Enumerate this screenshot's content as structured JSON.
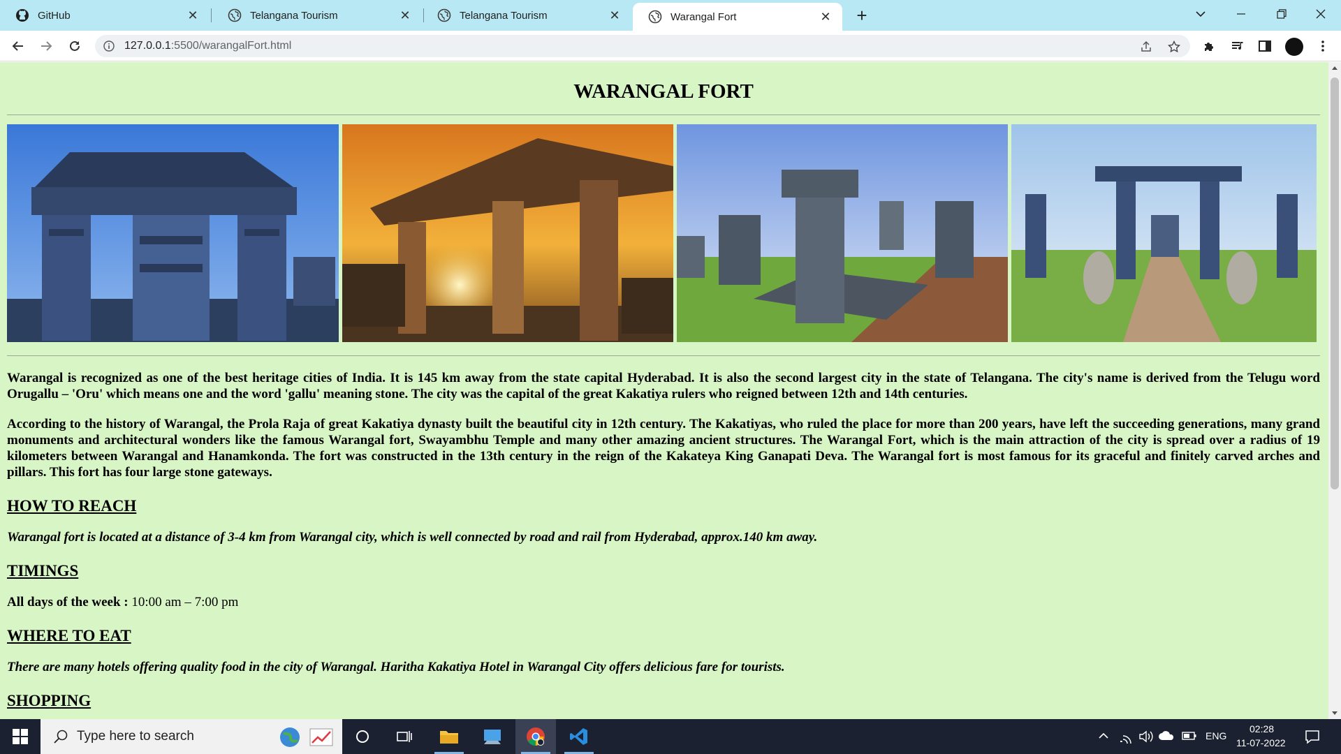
{
  "browser": {
    "tabs": [
      {
        "title": "GitHub",
        "icon": "github-icon",
        "active": false
      },
      {
        "title": "Telangana Tourism",
        "icon": "globe-icon",
        "active": false
      },
      {
        "title": "Telangana Tourism",
        "icon": "globe-icon",
        "active": false
      },
      {
        "title": "Warangal Fort",
        "icon": "globe-icon",
        "active": true
      }
    ],
    "url_host": "127.0.0.1",
    "url_path": ":5500/warangalFort.html"
  },
  "page": {
    "title": "WARANGAL FORT",
    "gallery": [
      {
        "alt": "thousand-pillar-temple-ruins-blue-photo"
      },
      {
        "alt": "sunset-pillared-mandapa-photo"
      },
      {
        "alt": "stone-pillars-garden-photo"
      },
      {
        "alt": "gateway-elephants-photo"
      }
    ],
    "intro": "Warangal is recognized as one of the best heritage cities of India. It is 145 km away from the state capital Hyderabad. It is also the second largest city in the state of Telangana. The city's name is derived from the Telugu word Orugallu – 'Oru' which means one and the word 'gallu' meaning stone. The city was the capital of the great Kakatiya rulers who reigned between 12th and 14th centuries.",
    "history": "According to the history of Warangal, the Prola Raja of great Kakatiya dynasty built the beautiful city in 12th century. The Kakatiyas, who ruled the place for more than 200 years, have left the succeeding generations, many grand monuments and architectural wonders like the famous Warangal fort, Swayambhu Temple and many other amazing ancient structures. The Warangal Fort, which is the main attraction of the city is spread over a radius of 19 kilometers between Warangal and Hanamkonda. The fort was constructed in the 13th century in the reign of the Kakateya King Ganapati Deva. The Warangal fort is most famous for its graceful and finitely carved arches and pillars. This fort has four large stone gateways.",
    "reach_heading": "HOW TO REACH",
    "reach_text": "Warangal fort is located at a distance of 3-4 km from Warangal city, which is well connected by road and rail from Hyderabad, approx.140 km away.",
    "timings_heading": "TIMINGS",
    "timings_label": "All days of the week :",
    "timings_value": "10:00 am – 7:00 pm",
    "eat_heading": "WHERE TO EAT",
    "eat_text": "There are many hotels offering quality food in the city of Warangal. Haritha Kakatiya Hotel in Warangal City offers delicious fare for tourists.",
    "shopping_heading": "SHOPPING"
  },
  "taskbar": {
    "search_placeholder": "Type here to search",
    "language": "ENG",
    "time": "02:28",
    "date": "11-07-2022"
  },
  "colors": {
    "page_background": "#d8f6c5",
    "tabstrip": "#b9e8f5",
    "taskbar": "#1b2130"
  }
}
